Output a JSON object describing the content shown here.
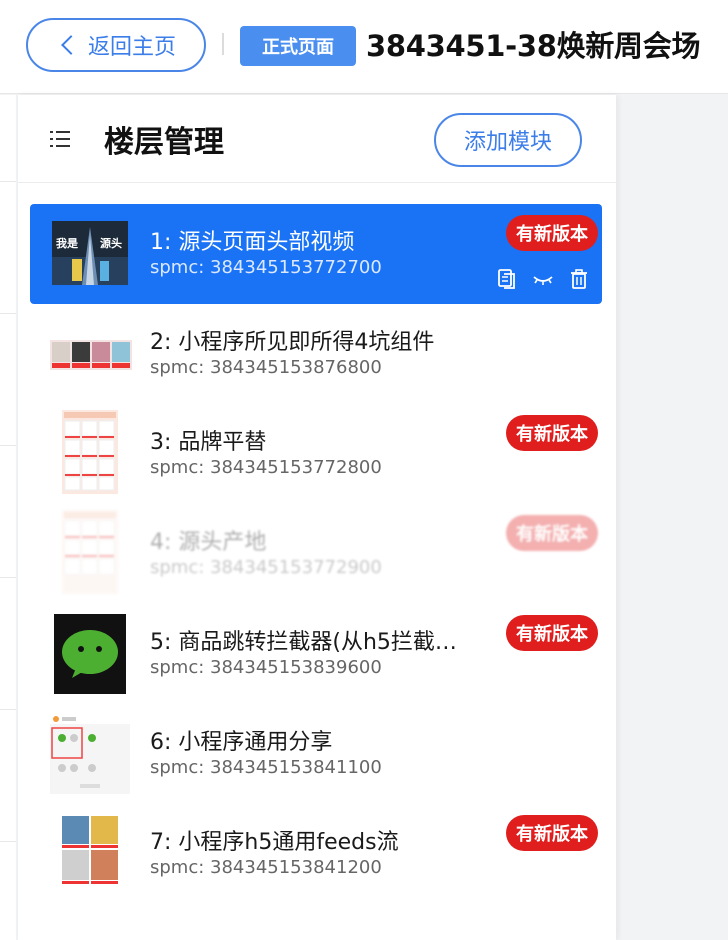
{
  "header": {
    "back_label": "返回主页",
    "env_badge": "正式页面",
    "title": "3843451-38焕新周会场"
  },
  "panel": {
    "title": "楼层管理",
    "add_label": "添加模块"
  },
  "modules": [
    {
      "name": "1: 源头页面头部视频",
      "spmc": "spmc: 384345153772700",
      "badge": "有新版本",
      "thumb": "video-banner-thumbnail",
      "thumb_text": [
        "我是",
        "源头"
      ]
    },
    {
      "name": "2: 小程序所见即所得4坑组件",
      "spmc": "spmc: 384345153876800",
      "badge": "",
      "thumb": "four-slot-component-thumbnail"
    },
    {
      "name": "3: 品牌平替",
      "spmc": "spmc: 384345153772800",
      "badge": "有新版本",
      "thumb": "product-grid-thumbnail"
    },
    {
      "name": "4: 源头产地",
      "spmc": "spmc: 384345153772900",
      "badge": "有新版本",
      "thumb": "product-grid-thumbnail"
    },
    {
      "name": "5: 商品跳转拦截器(从h5拦截…",
      "spmc": "spmc: 384345153839600",
      "badge": "有新版本",
      "thumb": "wechat-logo-thumbnail"
    },
    {
      "name": "6: 小程序通用分享",
      "spmc": "spmc: 384345153841100",
      "badge": "",
      "thumb": "share-panel-thumbnail"
    },
    {
      "name": "7: 小程序h5通用feeds流",
      "spmc": "spmc: 384345153841200",
      "badge": "有新版本",
      "thumb": "feeds-thumbnail"
    }
  ],
  "selected_actions": [
    "copy-icon",
    "hide-eye-icon",
    "trash-icon"
  ],
  "colors": {
    "accent": "#1a73f5",
    "outline_blue": "#4a86e8",
    "badge_red": "#e01e1e",
    "env_badge_blue": "#4a8ff0"
  }
}
